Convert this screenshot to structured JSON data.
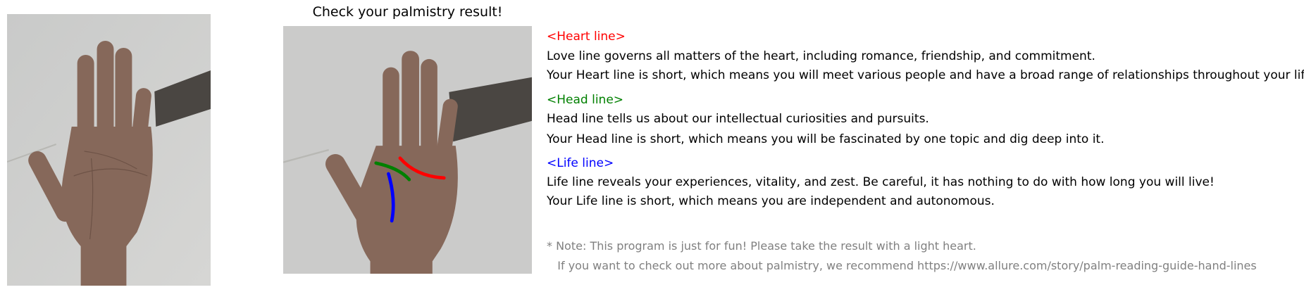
{
  "title": "Check your palmistry result!",
  "colors": {
    "heart": "#ff0000",
    "head": "#008000",
    "life": "#0000ff",
    "note": "#808080"
  },
  "sections": [
    {
      "heading": "<Heart line>",
      "description": "Love line governs all matters of the heart, including romance, friendship, and commitment.",
      "result": "Your Heart line is short, which means you will meet various people and have a broad range of relationships throughout your life."
    },
    {
      "heading": "<Head line>",
      "description": "Head line tells us about our intellectual curiosities and pursuits.",
      "result": "Your Head line is short, which means you will be fascinated by one topic and dig deep into it."
    },
    {
      "heading": "<Life line>",
      "description": "Life line reveals your experiences, vitality, and zest. Be careful, it has nothing to do with how long you will live!",
      "result": "Your Life line is short, which means you are independent and autonomous."
    }
  ],
  "note": {
    "line1": "* Note: This program is just for fun! Please take the result with a light heart.",
    "line2": "   If you want to check out more about palmistry, we recommend https://www.allure.com/story/palm-reading-guide-hand-lines"
  }
}
